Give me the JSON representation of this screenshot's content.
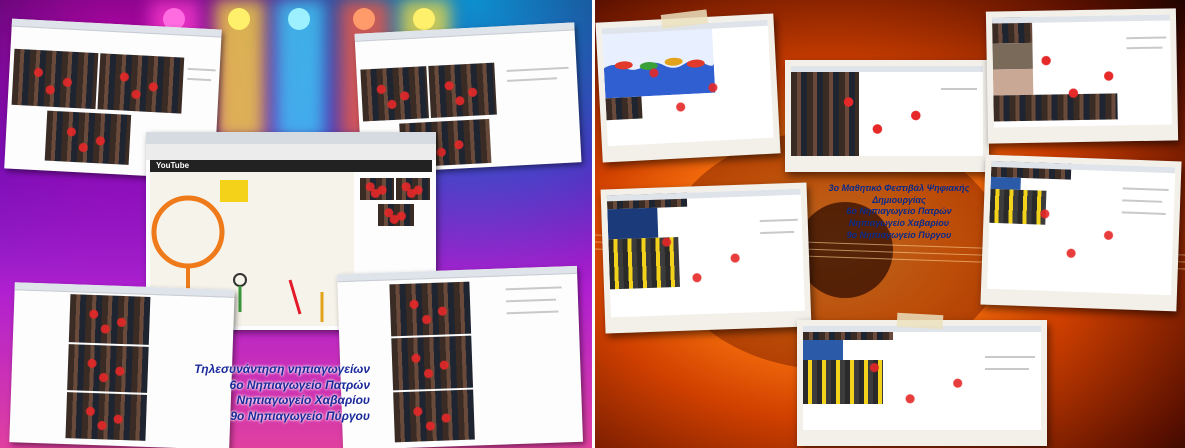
{
  "left_panel": {
    "caption": {
      "line1": "Τηλεσυνάντηση νηπιαγωγείων",
      "line2": "6ο Νηπιαγωγείο Πατρών",
      "line3": "Νηπιαγωγείο Χαβαρίου",
      "line4": "9ο Νηπιαγωγείο Πύργου"
    },
    "center_card_banner": "YouTube"
  },
  "right_panel": {
    "caption": {
      "line1": "3ο Μαθητικό Φεστιβάλ Ψηφιακής Δημιουργίας",
      "line2": "6ο Νηπιαγωγείο Πατρών",
      "line3": "Νηπιαγωγείο Χαβαρίου",
      "line4": "9ο Νηπιαγωγείο Πύργου"
    }
  },
  "colors": {
    "caption_left": "#1a2a9a",
    "caption_right": "#0a2a8a",
    "stage_bg": "#5a10b0",
    "guitar_bg": "#ff7a10"
  }
}
